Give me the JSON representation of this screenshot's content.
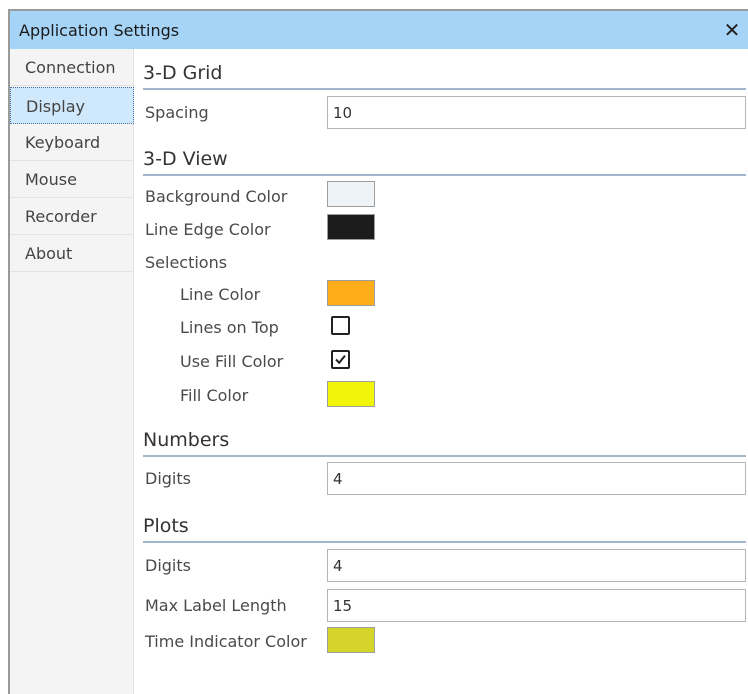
{
  "window": {
    "title": "Application Settings",
    "close_glyph": "✕"
  },
  "sidebar": {
    "items": [
      {
        "label": "Connection",
        "active": false
      },
      {
        "label": "Display",
        "active": true
      },
      {
        "label": "Keyboard",
        "active": false
      },
      {
        "label": "Mouse",
        "active": false
      },
      {
        "label": "Recorder",
        "active": false
      },
      {
        "label": "About",
        "active": false
      }
    ]
  },
  "grid3d": {
    "header": "3-D Grid",
    "spacing_label": "Spacing",
    "spacing_value": "10"
  },
  "view3d": {
    "header": "3-D View",
    "background_color_label": "Background Color",
    "background_color": "#eef3f8",
    "line_edge_color_label": "Line Edge Color",
    "line_edge_color": "#1c1c1c",
    "selections_label": "Selections",
    "selections": {
      "line_color_label": "Line Color",
      "line_color": "#ffad1a",
      "lines_on_top_label": "Lines on Top",
      "lines_on_top": false,
      "use_fill_color_label": "Use Fill Color",
      "use_fill_color": true,
      "fill_color_label": "Fill Color",
      "fill_color": "#f2f50a"
    }
  },
  "numbers": {
    "header": "Numbers",
    "digits_label": "Digits",
    "digits_value": "4"
  },
  "plots": {
    "header": "Plots",
    "digits_label": "Digits",
    "digits_value": "4",
    "max_label_length_label": "Max Label Length",
    "max_label_length_value": "15",
    "time_indicator_color_label": "Time Indicator Color",
    "time_indicator_color": "#d4d42a"
  },
  "colors": {
    "titlebar": "#a6d4f7",
    "sidebar_active": "#cfe8fb",
    "section_rule": "#a2b6cd"
  }
}
